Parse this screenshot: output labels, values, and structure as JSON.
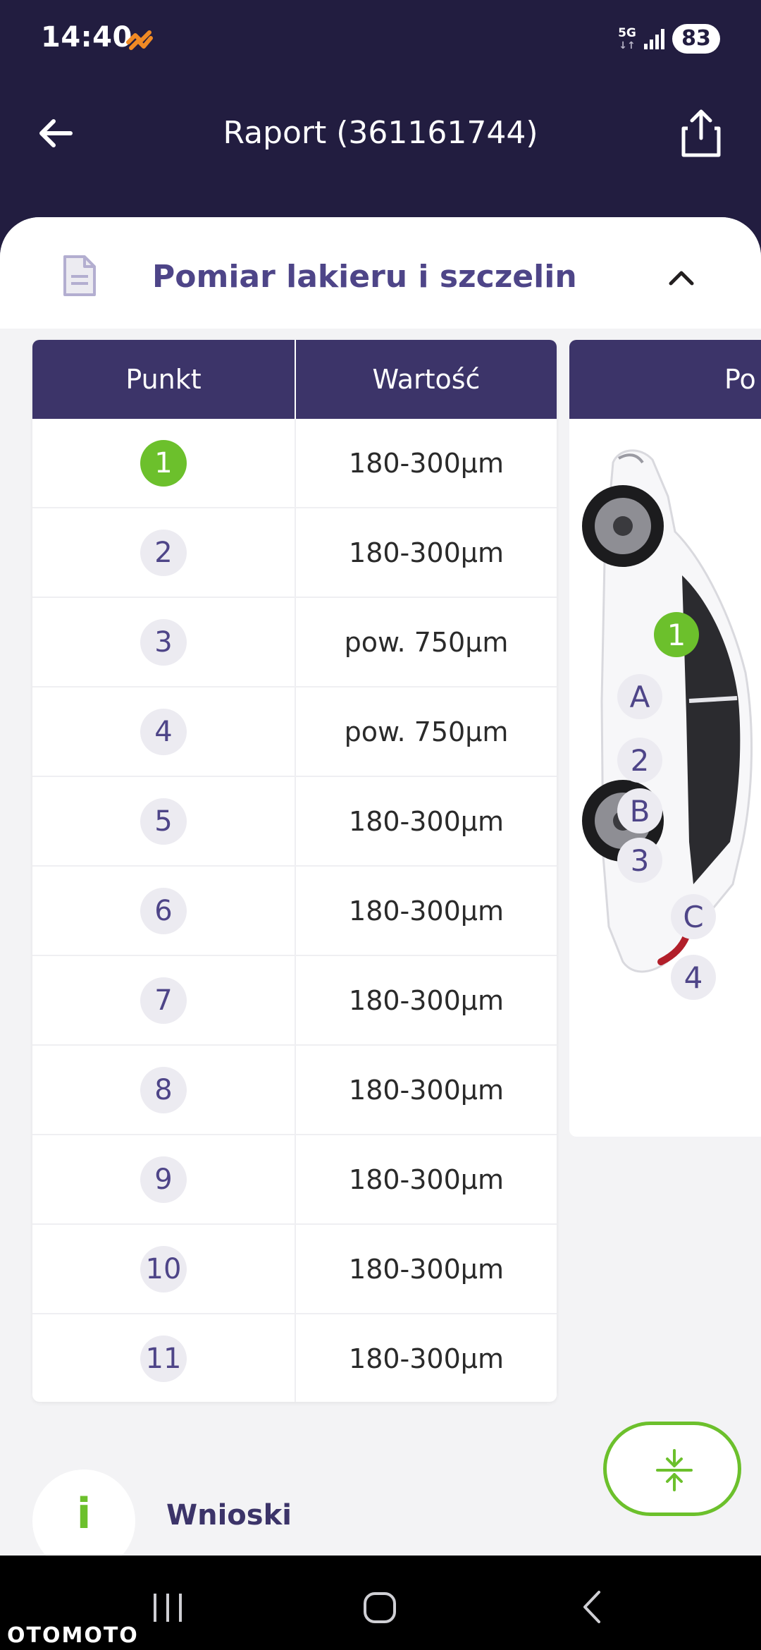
{
  "status_bar": {
    "time": "14:40",
    "network": "5G",
    "network_arrows": "↓↑",
    "battery": "83"
  },
  "header": {
    "title": "Raport (361161744)",
    "back_icon": "arrow-left-icon",
    "share_icon": "share-icon"
  },
  "section": {
    "title": "Pomiar lakieru i szczelin",
    "icon": "document-icon",
    "toggle_icon": "chevron-up-icon"
  },
  "table": {
    "headers": [
      "Punkt",
      "Wartość"
    ],
    "rows": [
      {
        "point": "1",
        "value": "180-300µm",
        "active": true
      },
      {
        "point": "2",
        "value": "180-300µm",
        "active": false
      },
      {
        "point": "3",
        "value": "pow. 750µm",
        "active": false
      },
      {
        "point": "4",
        "value": "pow. 750µm",
        "active": false
      },
      {
        "point": "5",
        "value": "180-300µm",
        "active": false
      },
      {
        "point": "6",
        "value": "180-300µm",
        "active": false
      },
      {
        "point": "7",
        "value": "180-300µm",
        "active": false
      },
      {
        "point": "8",
        "value": "180-300µm",
        "active": false
      },
      {
        "point": "9",
        "value": "180-300µm",
        "active": false
      },
      {
        "point": "10",
        "value": "180-300µm",
        "active": false
      },
      {
        "point": "11",
        "value": "180-300µm",
        "active": false
      }
    ]
  },
  "car_panel": {
    "header": "Po",
    "markers": {
      "m1": "1",
      "mA": "A",
      "m2": "2",
      "mB": "B",
      "m3": "3",
      "mC": "C",
      "m4": "4"
    }
  },
  "conclusions": {
    "icon_letter": "i",
    "label": "Wnioski"
  },
  "fab": {
    "icon": "collapse-vertical-icon"
  },
  "watermark": "OTOMOTO",
  "colors": {
    "header_bg": "#221d40",
    "table_header_bg": "#3c3469",
    "accent_purple": "#4e4588",
    "accent_green": "#6cc02c"
  }
}
